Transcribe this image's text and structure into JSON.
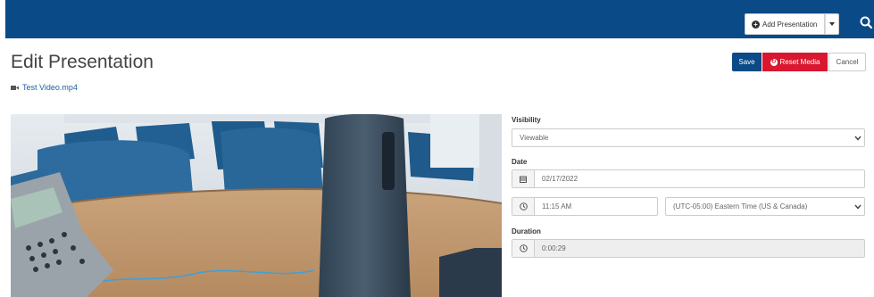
{
  "header": {
    "add_presentation_label": "Add Presentation"
  },
  "page": {
    "title": "Edit Presentation",
    "file_name": "Test Video.mp4"
  },
  "actions": {
    "save_label": "Save",
    "reset_label": "Reset Media",
    "cancel_label": "Cancel"
  },
  "form": {
    "visibility": {
      "label": "Visibility",
      "value": "Viewable"
    },
    "date": {
      "label": "Date",
      "value": "02/17/2022"
    },
    "time": {
      "value": "11:15 AM"
    },
    "timezone": {
      "value": "(UTC-05:00) Eastern Time (US & Canada)"
    },
    "duration": {
      "label": "Duration",
      "value": "0:00:29"
    }
  },
  "colors": {
    "header_bg": "#0a4a86",
    "save_bg": "#0a4a86",
    "reset_bg": "#d9182f",
    "link": "#1a5fa5"
  }
}
